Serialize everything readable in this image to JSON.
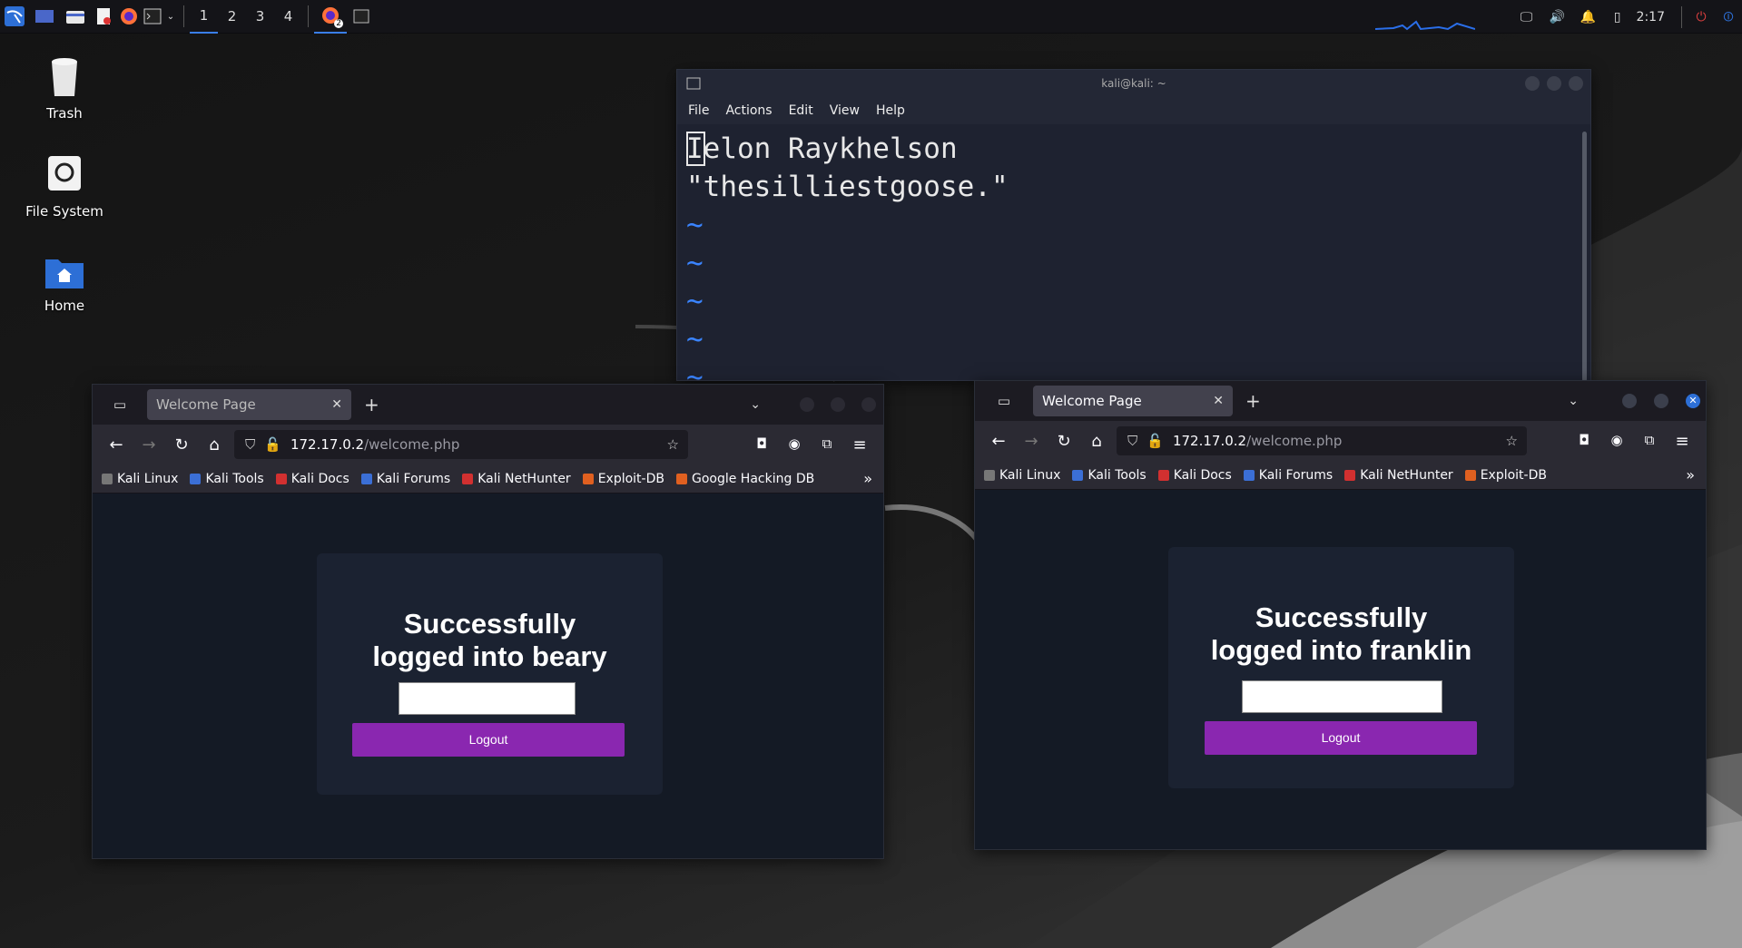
{
  "panel": {
    "workspaces": [
      "1",
      "2",
      "3",
      "4"
    ],
    "active_workspace": "1",
    "clock": "2:17",
    "task_badge": "2"
  },
  "desktop": {
    "icons": [
      {
        "label": "Trash",
        "icon": "trash-icon"
      },
      {
        "label": "File System",
        "icon": "drive-icon"
      },
      {
        "label": "Home",
        "icon": "home-folder-icon"
      }
    ]
  },
  "terminal": {
    "title": "kali@kali: ~",
    "menu": [
      "File",
      "Actions",
      "Edit",
      "View",
      "Help"
    ],
    "lines": [
      "Ielon Raykhelson",
      "\"thesilliestgoose.\""
    ],
    "tildes": [
      "~",
      "~",
      "~",
      "~",
      "~"
    ]
  },
  "browser_left": {
    "tab_title": "Welcome Page",
    "url_host": "172.17.0.2",
    "url_path": "/welcome.php",
    "bookmarks": [
      "Kali Linux",
      "Kali Tools",
      "Kali Docs",
      "Kali Forums",
      "Kali NetHunter",
      "Exploit-DB",
      "Google Hacking DB"
    ],
    "heading_line1": "Successfully",
    "heading_line2": "logged into beary",
    "logout_label": "Logout"
  },
  "browser_right": {
    "tab_title": "Welcome Page",
    "url_host": "172.17.0.2",
    "url_path": "/welcome.php",
    "bookmarks": [
      "Kali Linux",
      "Kali Tools",
      "Kali Docs",
      "Kali Forums",
      "Kali NetHunter",
      "Exploit-DB"
    ],
    "heading_line1": "Successfully",
    "heading_line2": "logged into franklin",
    "logout_label": "Logout"
  },
  "colors": {
    "accent": "#3a7ee8",
    "logout_button": "#8a27b0",
    "tilde": "#3a84ff"
  }
}
